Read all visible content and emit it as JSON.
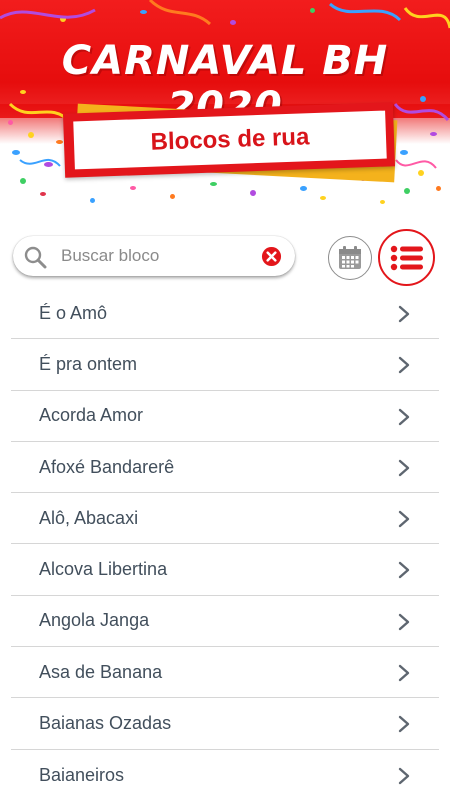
{
  "header": {
    "title": "CARNAVAL BH  2020",
    "subtitle": "Blocos de rua",
    "colors": {
      "brand_red": "#e3161b",
      "accent_yellow": "#f4b21c"
    }
  },
  "search": {
    "placeholder": "Buscar bloco",
    "value": "",
    "icon": "search-icon",
    "clear_icon": "clear-icon"
  },
  "view_toggle": {
    "calendar_icon": "calendar-icon",
    "list_icon": "list-icon",
    "active": "list"
  },
  "blocos": [
    {
      "label": "É o Amô"
    },
    {
      "label": "É pra ontem"
    },
    {
      "label": "Acorda Amor"
    },
    {
      "label": "Afoxé Bandarerê"
    },
    {
      "label": "Alô, Abacaxi"
    },
    {
      "label": "Alcova Libertina"
    },
    {
      "label": "Angola Janga"
    },
    {
      "label": "Asa de Banana"
    },
    {
      "label": "Baianas Ozadas"
    },
    {
      "label": "Baianeiros"
    }
  ]
}
